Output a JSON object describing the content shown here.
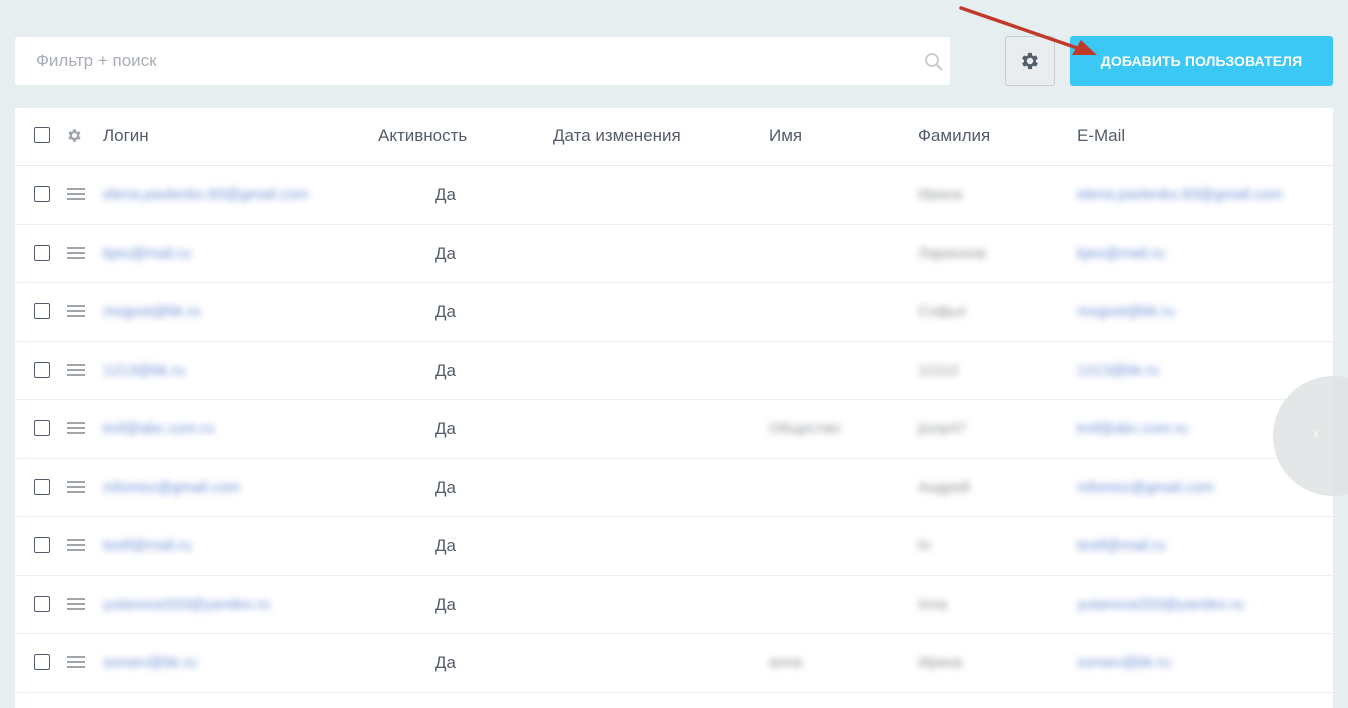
{
  "search": {
    "placeholder": "Фильтр + поиск"
  },
  "toolbar": {
    "add_user_label": "ДОБАВИТЬ ПОЛЬЗОВАТЕЛЯ"
  },
  "columns": [
    "Логин",
    "Активность",
    "Дата изменения",
    "Имя",
    "Фамилия",
    "E-Mail"
  ],
  "rows": [
    {
      "login": "elena.pavlenko.83@gmail.com",
      "active": "Да",
      "name": "",
      "surname": "Ирина",
      "email": "elena.pavlenko.83@gmail.com"
    },
    {
      "login": "kjeo@mail.ru",
      "active": "Да",
      "name": "",
      "surname": "Ларионов",
      "email": "kjeo@mail.ru"
    },
    {
      "login": "mogost@bk.ru",
      "active": "Да",
      "name": "",
      "surname": "Софья",
      "email": "mogost@bk.ru"
    },
    {
      "login": "1213@bk.ru",
      "active": "Да",
      "name": "",
      "surname": "12112",
      "email": "1213@bk.ru"
    },
    {
      "login": "trof@abc.com.ru",
      "active": "Да",
      "name": "Общество",
      "surname": "jiunp47",
      "email": "trof@abc.com.ru"
    },
    {
      "login": "mfomez@gmail.com",
      "active": "Да",
      "name": "",
      "surname": "Андрей",
      "email": "mfomez@gmail.com"
    },
    {
      "login": "testf@mail.ru",
      "active": "Да",
      "name": "",
      "surname": "hr",
      "email": "testf@mail.ru"
    },
    {
      "login": "yutanova333@yandex.ru",
      "active": "Да",
      "name": "",
      "surname": "Inna",
      "email": "yutanova333@yandex.ru"
    },
    {
      "login": "soroev@bk.ru",
      "active": "Да",
      "name": "anna",
      "surname": "Ирина",
      "email": "soroev@bk.ru"
    }
  ],
  "colors": {
    "accent": "#3bc8f5",
    "background": "#e7eef0",
    "arrow": "#c0392b"
  }
}
